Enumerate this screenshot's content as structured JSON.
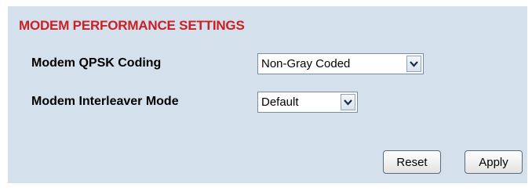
{
  "panel": {
    "title": "MODEM PERFORMANCE SETTINGS"
  },
  "qpsk": {
    "label": "Modem QPSK Coding",
    "value": "Non-Gray Coded"
  },
  "interleaver": {
    "label": "Modem Interleaver Mode",
    "value": "Default"
  },
  "buttons": {
    "reset": "Reset",
    "apply": "Apply"
  },
  "colors": {
    "panel_bg": "#d4e0eb",
    "title": "#cc1f25"
  },
  "icons": {
    "dropdown": "chevron-down-icon"
  }
}
